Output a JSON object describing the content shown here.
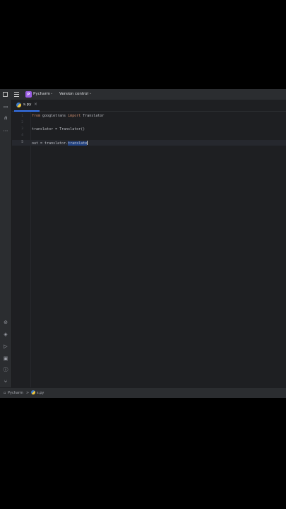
{
  "titlebar": {
    "project_badge": "P",
    "project_name": "Pycharm",
    "vcs_label": "Version control"
  },
  "tabs": [
    {
      "label": "s.py",
      "close": "×"
    }
  ],
  "editor": {
    "line_numbers": [
      "1",
      "2",
      "3",
      "4",
      "5"
    ],
    "active_line": "5",
    "lines": {
      "l1_kw1": "from",
      "l1_mod": " googletrans ",
      "l1_kw2": "import",
      "l1_name": " Translator",
      "l3": "translator = Translator()",
      "l5_prefix": "out = translator.",
      "l5_selected": "translate"
    }
  },
  "statusbar": {
    "project": "Pycharm",
    "separator": ">",
    "file": "s.py"
  },
  "icons": {
    "project": "folder-icon",
    "structure": "structure-icon",
    "python_packages": "layers-icon",
    "run": "run-icon",
    "terminal": "terminal-icon",
    "problems": "problems-icon",
    "git": "git-icon"
  },
  "colors": {
    "accent": "#3574f0",
    "keyword": "#cf8e6d",
    "badge": "#9b5de5"
  }
}
